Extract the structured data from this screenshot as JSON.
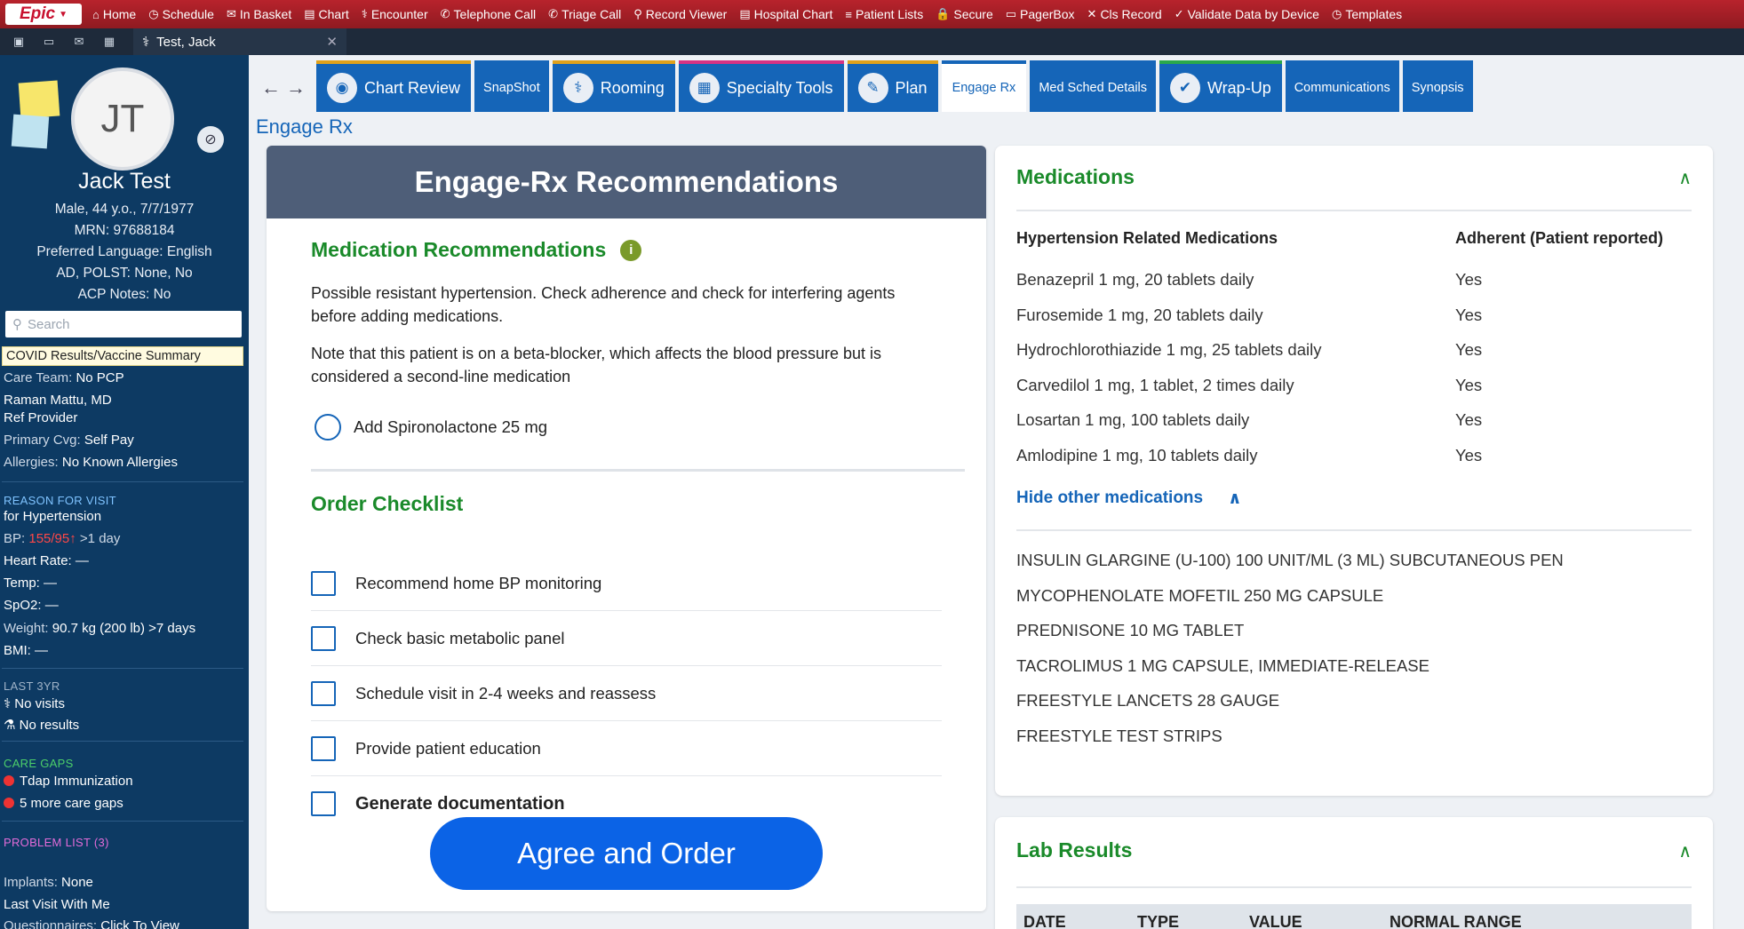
{
  "topbar": {
    "logo": "Epic",
    "items": [
      {
        "icon": "home-icon",
        "glyph": "⌂",
        "label": "Home"
      },
      {
        "icon": "clock-icon",
        "glyph": "◷",
        "label": "Schedule"
      },
      {
        "icon": "inbox-icon",
        "glyph": "✉",
        "label": "In Basket"
      },
      {
        "icon": "chart-icon",
        "glyph": "▤",
        "label": "Chart"
      },
      {
        "icon": "encounter-icon",
        "glyph": "⚕",
        "label": "Encounter"
      },
      {
        "icon": "phone-icon",
        "glyph": "✆",
        "label": "Telephone Call"
      },
      {
        "icon": "triage-phone-icon",
        "glyph": "✆",
        "label": "Triage Call"
      },
      {
        "icon": "binoculars-icon",
        "glyph": "⚲",
        "label": "Record Viewer"
      },
      {
        "icon": "hospital-chart-icon",
        "glyph": "▤",
        "label": "Hospital Chart"
      },
      {
        "icon": "list-icon",
        "glyph": "≡",
        "label": "Patient Lists"
      },
      {
        "icon": "lock-icon",
        "glyph": "🔒",
        "label": "Secure"
      },
      {
        "icon": "pager-icon",
        "glyph": "▭",
        "label": "PagerBox"
      },
      {
        "icon": "x-icon",
        "glyph": "✕",
        "label": "Cls Record"
      },
      {
        "icon": "validate-icon",
        "glyph": "✓",
        "label": "Validate Data by Device"
      },
      {
        "icon": "templates-icon",
        "glyph": "◷",
        "label": "Templates"
      }
    ]
  },
  "subbar": {
    "patient_tab": "Test, Jack"
  },
  "sidebar": {
    "initials": "JT",
    "name": "Jack Test",
    "demographics": "Male, 44 y.o., 7/7/1977",
    "mrn": "MRN: 97688184",
    "language": "Preferred Language: English",
    "ad_polst": "AD, POLST: None, No",
    "acp": "ACP Notes: No",
    "search_placeholder": "Search",
    "covid": "COVID Results/Vaccine Summary",
    "care_team_label": "Care Team:",
    "care_team_value": "No PCP",
    "provider": "Raman Mattu, MD",
    "provider_role": "Ref Provider",
    "coverage_label": "Primary Cvg:",
    "coverage_value": "Self Pay",
    "allergies_label": "Allergies:",
    "allergies_value": "No Known Allergies",
    "reason_head": "REASON FOR VISIT",
    "reason_value": "for Hypertension",
    "bp_label": "BP:",
    "bp_value": "155/95",
    "bp_arrow": "↑",
    "bp_age": ">1 day",
    "hr": "Heart Rate: —",
    "temp": "Temp: —",
    "spo2": "SpO2: —",
    "weight_label": "Weight:",
    "weight_value": "90.7 kg (200 lb) >7 days",
    "bmi": "BMI: —",
    "last3_head": "LAST 3YR",
    "visits": "No visits",
    "results": "No results",
    "gaps_head": "CARE GAPS",
    "gap1": "Tdap Immunization",
    "gap2": "5 more care gaps",
    "problems_head": "PROBLEM LIST (3)",
    "implants_label": "Implants:",
    "implants_value": "None",
    "last_visit": "Last Visit With Me",
    "questionnaires_label": "Questionnaires:",
    "questionnaires_value": "Click To View"
  },
  "tabs": [
    {
      "label": "Chart Review",
      "icon": "chart-review-icon",
      "glyph": "◉",
      "style": "icon"
    },
    {
      "label": "SnapShot",
      "style": "small"
    },
    {
      "label": "Rooming",
      "icon": "rooming-icon",
      "glyph": "⚕",
      "style": "icon"
    },
    {
      "label": "Specialty Tools",
      "icon": "specialty-tools-icon",
      "glyph": "▦",
      "style": "pink"
    },
    {
      "label": "Plan",
      "icon": "plan-icon",
      "glyph": "✎",
      "style": "icon"
    },
    {
      "label": "Engage Rx",
      "style": "active"
    },
    {
      "label": "Med Sched Details",
      "style": "small"
    },
    {
      "label": "Wrap-Up",
      "icon": "wrap-up-icon",
      "glyph": "✔",
      "style": "green"
    },
    {
      "label": "Communications",
      "style": "small"
    },
    {
      "label": "Synopsis",
      "style": "small"
    }
  ],
  "breadcrumb": "Engage Rx",
  "recommendations": {
    "header": "Engage-Rx Recommendations",
    "section_title": "Medication Recommendations",
    "info_glyph": "i",
    "para1": "Possible resistant hypertension. Check adherence and check for interfering agents before adding medications.",
    "para2": "Note that this patient is on a beta-blocker, which affects the blood pressure but is considered a second-line medication",
    "option": "Add Spironolactone 25 mg",
    "checklist_title": "Order Checklist",
    "checklist": [
      "Recommend home BP monitoring",
      "Check basic metabolic panel",
      "Schedule visit in 2-4 weeks and reassess",
      "Provide patient education",
      "Generate documentation"
    ],
    "button": "Agree and Order"
  },
  "medications": {
    "title": "Medications",
    "col1": "Hypertension Related Medications",
    "col2": "Adherent (Patient reported)",
    "rows": [
      {
        "name": "Benazepril 1 mg, 20 tablets daily",
        "adherent": "Yes"
      },
      {
        "name": "Furosemide 1 mg, 20 tablets daily",
        "adherent": "Yes"
      },
      {
        "name": "Hydrochlorothiazide 1 mg, 25 tablets daily",
        "adherent": "Yes"
      },
      {
        "name": "Carvedilol 1 mg, 1 tablet, 2 times daily",
        "adherent": "Yes"
      },
      {
        "name": "Losartan 1 mg, 100 tablets daily",
        "adherent": "Yes"
      },
      {
        "name": "Amlodipine 1 mg, 10 tablets daily",
        "adherent": "Yes"
      }
    ],
    "hide_link": "Hide other medications",
    "other": [
      "INSULIN GLARGINE (U-100) 100 UNIT/ML (3 ML) SUBCUTANEOUS PEN",
      "MYCOPHENOLATE MOFETIL 250 MG CAPSULE",
      "PREDNISONE 10 MG TABLET",
      "TACROLIMUS 1 MG CAPSULE, IMMEDIATE-RELEASE",
      "FREESTYLE LANCETS 28 GAUGE",
      "FREESTYLE TEST STRIPS"
    ]
  },
  "labs": {
    "title": "Lab Results",
    "columns": [
      "DATE",
      "TYPE",
      "VALUE",
      "NORMAL RANGE"
    ]
  }
}
